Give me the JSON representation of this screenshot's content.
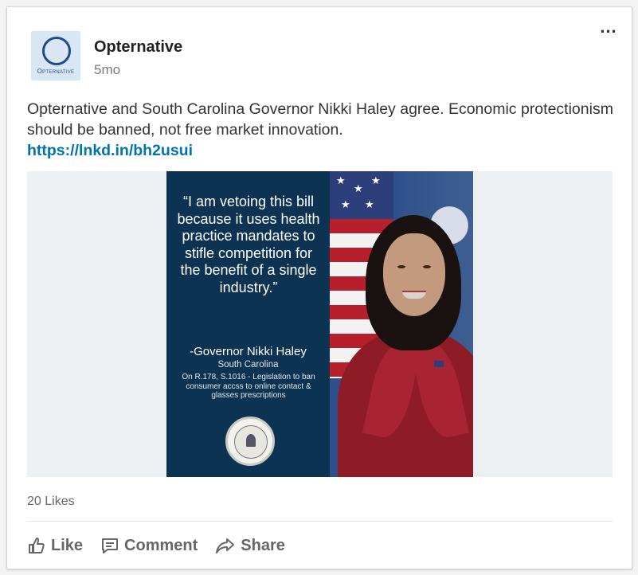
{
  "post": {
    "author": "Opternative",
    "time": "5mo",
    "logo_text": "Opternative",
    "more_label": "...",
    "text": "Opternative and South Carolina Governor Nikki Haley agree. Economic protectionism should be banned, not free market innovation.",
    "link": "https://lnkd.in/bh2usui"
  },
  "image": {
    "quote": "“I am vetoing this bill because it uses health practice mandates to stifle competition for the benefit of a single industry.”",
    "attribution": "-Governor Nikki Haley",
    "state": "South Carolina",
    "bill": "On R.178, S.1016 - Legislation to ban consumer accss to online contact  & glasses prescriptions"
  },
  "social": {
    "likes": "20 Likes"
  },
  "actions": {
    "like": "Like",
    "comment": "Comment",
    "share": "Share"
  },
  "colors": {
    "link": "#0073b1",
    "quote_panel": "#0c3352",
    "logo_bg": "#d9e7f5"
  }
}
